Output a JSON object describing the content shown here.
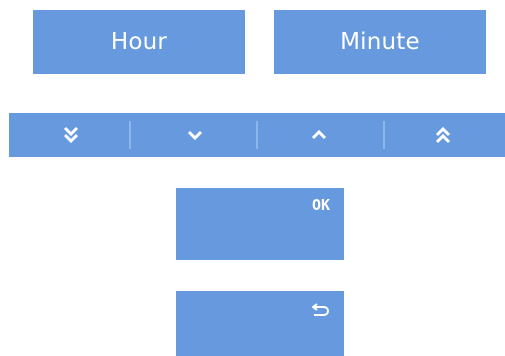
{
  "colors": {
    "accent": "#6699dd",
    "text": "#ffffff"
  },
  "mode_buttons": {
    "hour_label": "Hour",
    "minute_label": "Minute"
  },
  "arrow_bar": {
    "icons": [
      "double-chevron-down-icon",
      "chevron-down-icon",
      "chevron-up-icon",
      "double-chevron-up-icon"
    ]
  },
  "actions": {
    "ok_label": "OK",
    "back_icon": "return-icon"
  }
}
